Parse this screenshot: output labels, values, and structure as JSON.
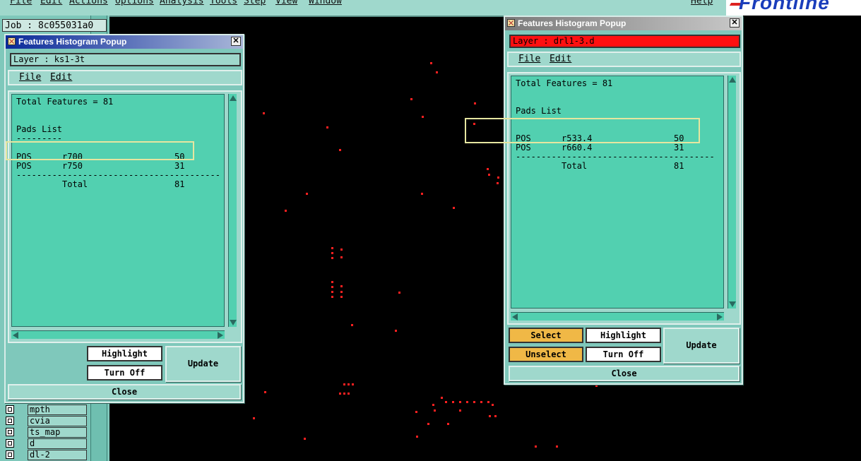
{
  "top_menu": [
    "File",
    "Edit",
    "Actions",
    "Options",
    "Analysis",
    "Tools",
    "Step",
    "View",
    "Window",
    "Help"
  ],
  "brand": {
    "logo_text": "Frontline"
  },
  "job": {
    "label": "Job : 8c055031a0"
  },
  "layers": [
    "mpth",
    "cvia",
    "ts_map",
    "d",
    "dl-2"
  ],
  "popup_left": {
    "title": "Features Histogram Popup",
    "layer_field": "Layer :  ks1-3t",
    "menu": [
      "File",
      "Edit"
    ],
    "lines": [
      "Total Features = 81",
      "",
      "Pads List",
      "---------",
      "POS      r700                  50",
      "POS      r750                  31",
      "----------------------------------------",
      "         Total                 81"
    ],
    "buttons": {
      "highlight": "Highlight",
      "turn_off": "Turn Off",
      "update": "Update",
      "close": "Close"
    }
  },
  "popup_right": {
    "title": "Features Histogram Popup",
    "layer_field": "Layer :  drl1-3.d",
    "layer_color": "#ff1010",
    "menu": [
      "File",
      "Edit"
    ],
    "lines": [
      "Total Features = 81",
      "",
      "Pads List",
      "",
      "POS      r533.4                50",
      "POS      r660.4                31",
      "---------------------------------------",
      "         Total                 81"
    ],
    "buttons": {
      "select": "Select",
      "unselect": "Unselect",
      "highlight": "Highlight",
      "turn_off": "Turn Off",
      "update": "Update",
      "close": "Close"
    }
  },
  "colors": {
    "panel": "#7fc8bb",
    "text_bg": "#52d0b0",
    "canvas": "#000000",
    "dots": "#ff2020",
    "button_yellow": "#f0b846"
  }
}
